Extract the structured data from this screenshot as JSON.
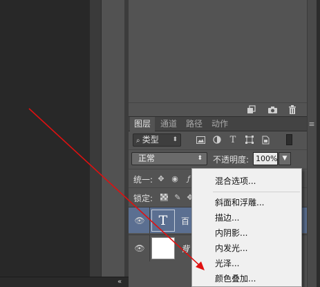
{
  "bottom_bar": {
    "collapse_label": "«",
    "close_label": "×"
  },
  "panel_footer": {
    "icons": [
      "new-layer-comp-icon",
      "camera-icon",
      "trash-icon"
    ]
  },
  "layers_panel": {
    "tabs": [
      {
        "label": "图层",
        "active": true
      },
      {
        "label": "通道",
        "active": false
      },
      {
        "label": "路径",
        "active": false
      },
      {
        "label": "动作",
        "active": false
      }
    ],
    "menu_glyph": "≡",
    "filter": {
      "value": "类型"
    },
    "blend_mode": {
      "value": "正常"
    },
    "opacity": {
      "label": "不透明度:",
      "value": "100%"
    },
    "unify": {
      "label": "统一:"
    },
    "lock": {
      "label": "锁定:"
    },
    "layers": [
      {
        "name": "百",
        "type": "text",
        "thumb_glyph": "T",
        "selected": true,
        "italic": false
      },
      {
        "name": "背",
        "type": "image",
        "thumb_glyph": "",
        "selected": false,
        "italic": true
      }
    ]
  },
  "context_menu": {
    "items": [
      "混合选项...",
      "斜面和浮雕...",
      "描边...",
      "内阴影...",
      "内发光...",
      "光泽...",
      "颜色叠加..."
    ]
  },
  "colors": {
    "panel_bg": "#535353",
    "selected_layer": "#5b6f91",
    "annotation_arrow": "#e01010"
  }
}
